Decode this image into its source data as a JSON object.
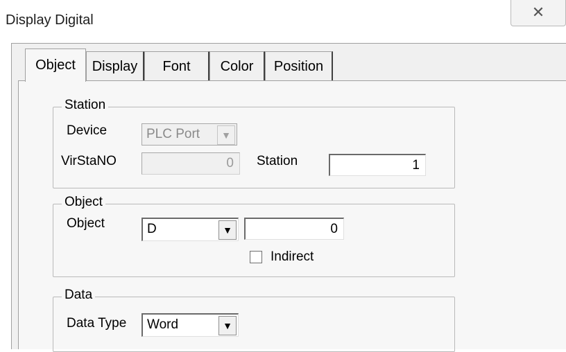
{
  "window": {
    "title": "Display Digital",
    "close_glyph": "✕"
  },
  "tabs": [
    {
      "label": "Object",
      "active": true
    },
    {
      "label": "Display"
    },
    {
      "label": "Font"
    },
    {
      "label": "Color"
    },
    {
      "label": "Position"
    }
  ],
  "station": {
    "legend": "Station",
    "device_label": "Device",
    "device_value": "PLC Port",
    "virstano_label": "VirStaNO",
    "virstano_value": "0",
    "station_label": "Station",
    "station_value": "1"
  },
  "object": {
    "legend": "Object",
    "object_label": "Object",
    "object_type": "D",
    "object_address": "0",
    "indirect_label": "Indirect",
    "indirect_checked": false
  },
  "data": {
    "legend": "Data",
    "data_type_label": "Data Type",
    "data_type_value": "Word"
  },
  "icons": {
    "dropdown": "▼"
  }
}
